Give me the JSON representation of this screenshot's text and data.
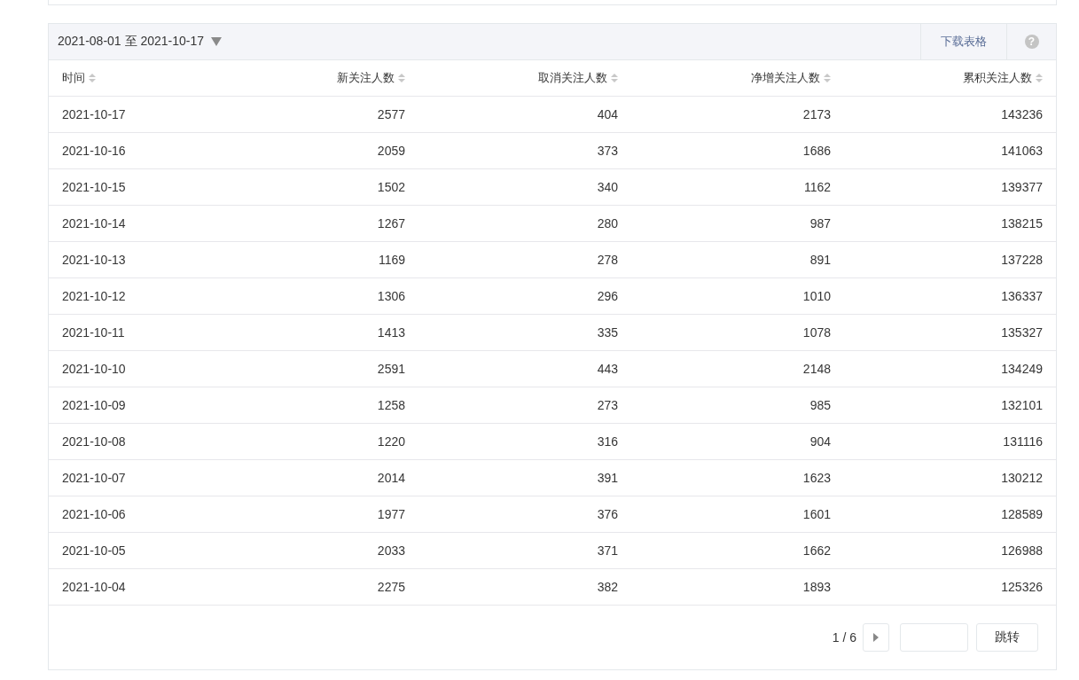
{
  "date_range": {
    "label": "2021-08-01 至 2021-10-17"
  },
  "toolbar": {
    "download_button": "下载表格",
    "help_button": "?"
  },
  "table": {
    "columns": [
      {
        "label": "时间"
      },
      {
        "label": "新关注人数"
      },
      {
        "label": "取消关注人数"
      },
      {
        "label": "净增关注人数"
      },
      {
        "label": "累积关注人数"
      }
    ],
    "rows": [
      [
        "2021-10-17",
        "2577",
        "404",
        "2173",
        "143236"
      ],
      [
        "2021-10-16",
        "2059",
        "373",
        "1686",
        "141063"
      ],
      [
        "2021-10-15",
        "1502",
        "340",
        "1162",
        "139377"
      ],
      [
        "2021-10-14",
        "1267",
        "280",
        "987",
        "138215"
      ],
      [
        "2021-10-13",
        "1169",
        "278",
        "891",
        "137228"
      ],
      [
        "2021-10-12",
        "1306",
        "296",
        "1010",
        "136337"
      ],
      [
        "2021-10-11",
        "1413",
        "335",
        "1078",
        "135327"
      ],
      [
        "2021-10-10",
        "2591",
        "443",
        "2148",
        "134249"
      ],
      [
        "2021-10-09",
        "1258",
        "273",
        "985",
        "132101"
      ],
      [
        "2021-10-08",
        "1220",
        "316",
        "904",
        "131116"
      ],
      [
        "2021-10-07",
        "2014",
        "391",
        "1623",
        "130212"
      ],
      [
        "2021-10-06",
        "1977",
        "376",
        "1601",
        "128589"
      ],
      [
        "2021-10-05",
        "2033",
        "371",
        "1662",
        "126988"
      ],
      [
        "2021-10-04",
        "2275",
        "382",
        "1893",
        "125326"
      ]
    ]
  },
  "pagination": {
    "page_info": "1 / 6",
    "jump_button": "跳转"
  }
}
